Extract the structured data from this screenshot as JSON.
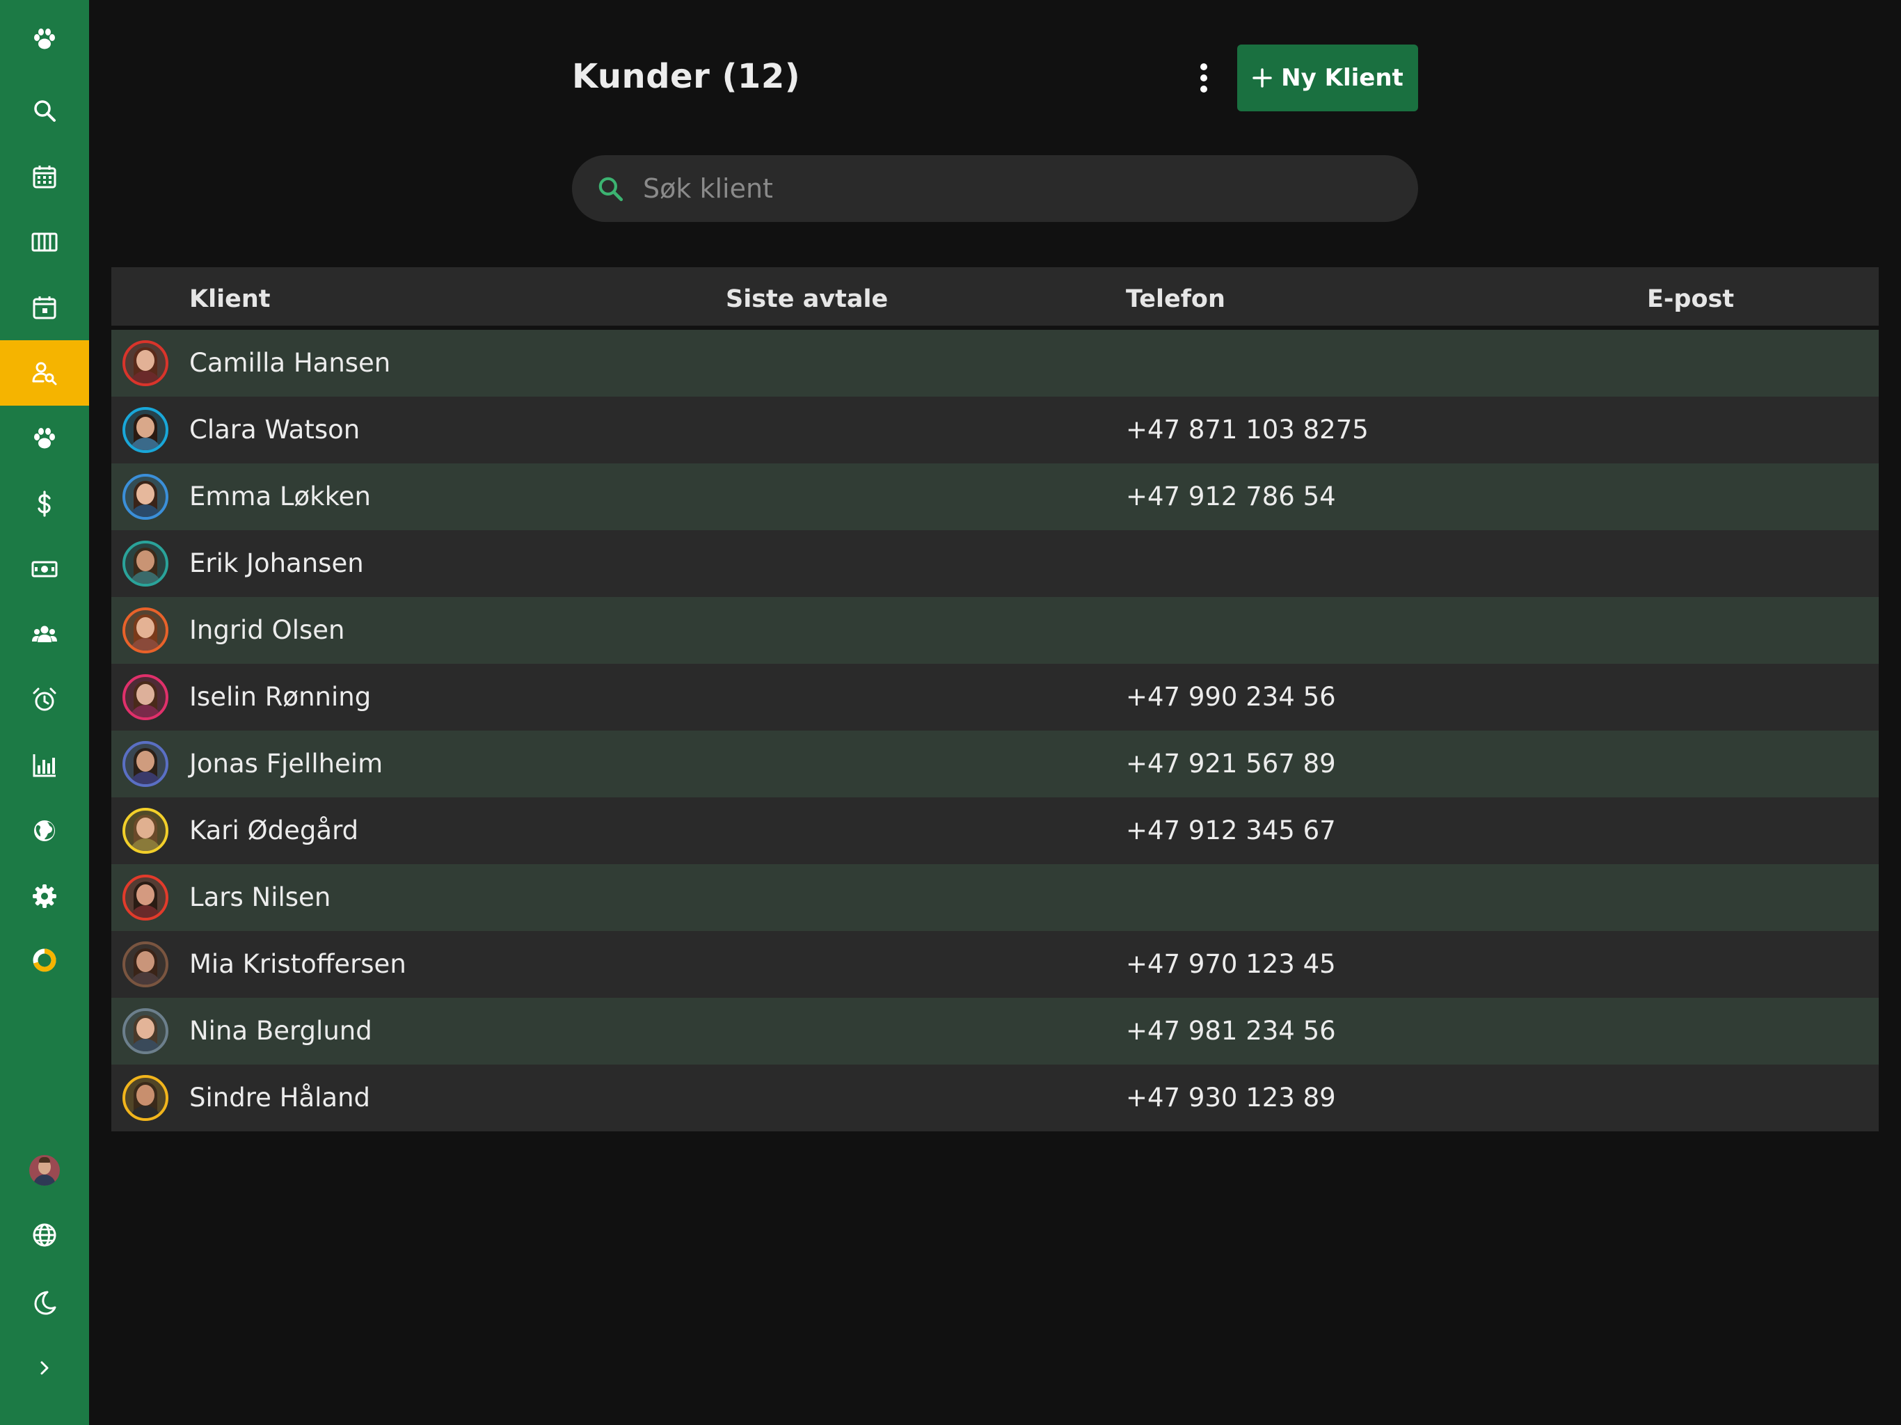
{
  "header": {
    "title": "Kunder (12)",
    "new_button_label": "Ny Klient"
  },
  "search": {
    "placeholder": "Søk klient",
    "value": ""
  },
  "sidebar": {
    "active": "clients",
    "items": [
      {
        "icon": "paw-logo-icon"
      },
      {
        "icon": "search-icon"
      },
      {
        "icon": "calendar-icon"
      },
      {
        "icon": "columns-icon"
      },
      {
        "icon": "calendar-day-icon"
      },
      {
        "icon": "client-search-icon"
      },
      {
        "icon": "paw-icon"
      },
      {
        "icon": "dollar-icon"
      },
      {
        "icon": "cash-icon"
      },
      {
        "icon": "group-icon"
      },
      {
        "icon": "alarm-icon"
      },
      {
        "icon": "bar-chart-icon"
      },
      {
        "icon": "globe-icon"
      },
      {
        "icon": "gear-icon"
      },
      {
        "icon": "donut-icon"
      },
      {
        "icon": "user-avatar"
      },
      {
        "icon": "language-globe-icon"
      },
      {
        "icon": "moon-icon"
      },
      {
        "icon": "chevron-right-icon"
      }
    ]
  },
  "table": {
    "columns": [
      "Klient",
      "Siste avtale",
      "Telefon",
      "E-post"
    ],
    "rows": [
      {
        "name": "Camilla Hansen",
        "last_appointment": "",
        "phone": "",
        "email": "",
        "ring_color": "#d9342b"
      },
      {
        "name": "Clara Watson",
        "last_appointment": "",
        "phone": "+47 871 103 8275",
        "email": "",
        "ring_color": "#19a7d9"
      },
      {
        "name": "Emma Løkken",
        "last_appointment": "",
        "phone": "+47 912 786 54",
        "email": "",
        "ring_color": "#3b8fd9"
      },
      {
        "name": "Erik Johansen",
        "last_appointment": "",
        "phone": "",
        "email": "",
        "ring_color": "#2aa39a"
      },
      {
        "name": "Ingrid Olsen",
        "last_appointment": "",
        "phone": "",
        "email": "",
        "ring_color": "#e8622a"
      },
      {
        "name": "Iselin Rønning",
        "last_appointment": "",
        "phone": "+47 990 234 56",
        "email": "",
        "ring_color": "#e0306b"
      },
      {
        "name": "Jonas Fjellheim",
        "last_appointment": "",
        "phone": "+47 921 567 89",
        "email": "",
        "ring_color": "#5a6fc4"
      },
      {
        "name": "Kari Ødegård",
        "last_appointment": "",
        "phone": "+47 912 345 67",
        "email": "",
        "ring_color": "#f2cf2a"
      },
      {
        "name": "Lars Nilsen",
        "last_appointment": "",
        "phone": "",
        "email": "",
        "ring_color": "#e23b2b"
      },
      {
        "name": "Mia Kristoffersen",
        "last_appointment": "",
        "phone": "+47 970 123 45",
        "email": "",
        "ring_color": "#7a5540"
      },
      {
        "name": "Nina Berglund",
        "last_appointment": "",
        "phone": "+47 981 234 56",
        "email": "",
        "ring_color": "#6c7f8c"
      },
      {
        "name": "Sindre Håland",
        "last_appointment": "",
        "phone": "+47 930 123 89",
        "email": "",
        "ring_color": "#f2b51c"
      }
    ]
  },
  "colors": {
    "sidebar_bg": "#1c7a45",
    "sidebar_active": "#f5b400",
    "primary_button": "#1a7040",
    "row_odd": "#313d35",
    "row_even": "#2a2a2a"
  }
}
